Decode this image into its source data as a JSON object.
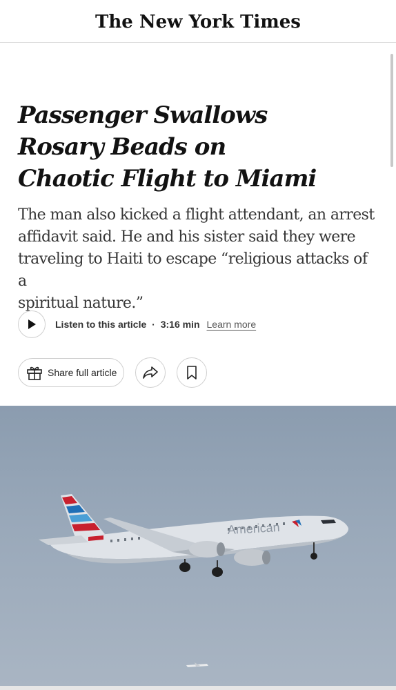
{
  "masthead": {
    "logo_text": "The New York Times"
  },
  "article": {
    "headline_lines": [
      "Passenger Swallows",
      "Rosary Beads on",
      "Chaotic Flight to Miami"
    ],
    "summary_lines": [
      "The man also kicked a flight attendant, an arrest",
      "affidavit said. He and his sister said they were",
      "traveling to Haiti to escape “religious attacks of a",
      "spiritual nature.”"
    ]
  },
  "audio": {
    "listen_label": "Listen to this article",
    "separator": "·",
    "duration": "3:16 min",
    "learn_more": "Learn more",
    "play_icon": "play-icon"
  },
  "actions": {
    "share_label": "Share full article",
    "share_icon": "gift-icon",
    "forward_icon": "share-arrow-icon",
    "bookmark_icon": "bookmark-icon"
  },
  "photo": {
    "airline_livery_text": "American",
    "sky_color": "#9aa9ba"
  }
}
